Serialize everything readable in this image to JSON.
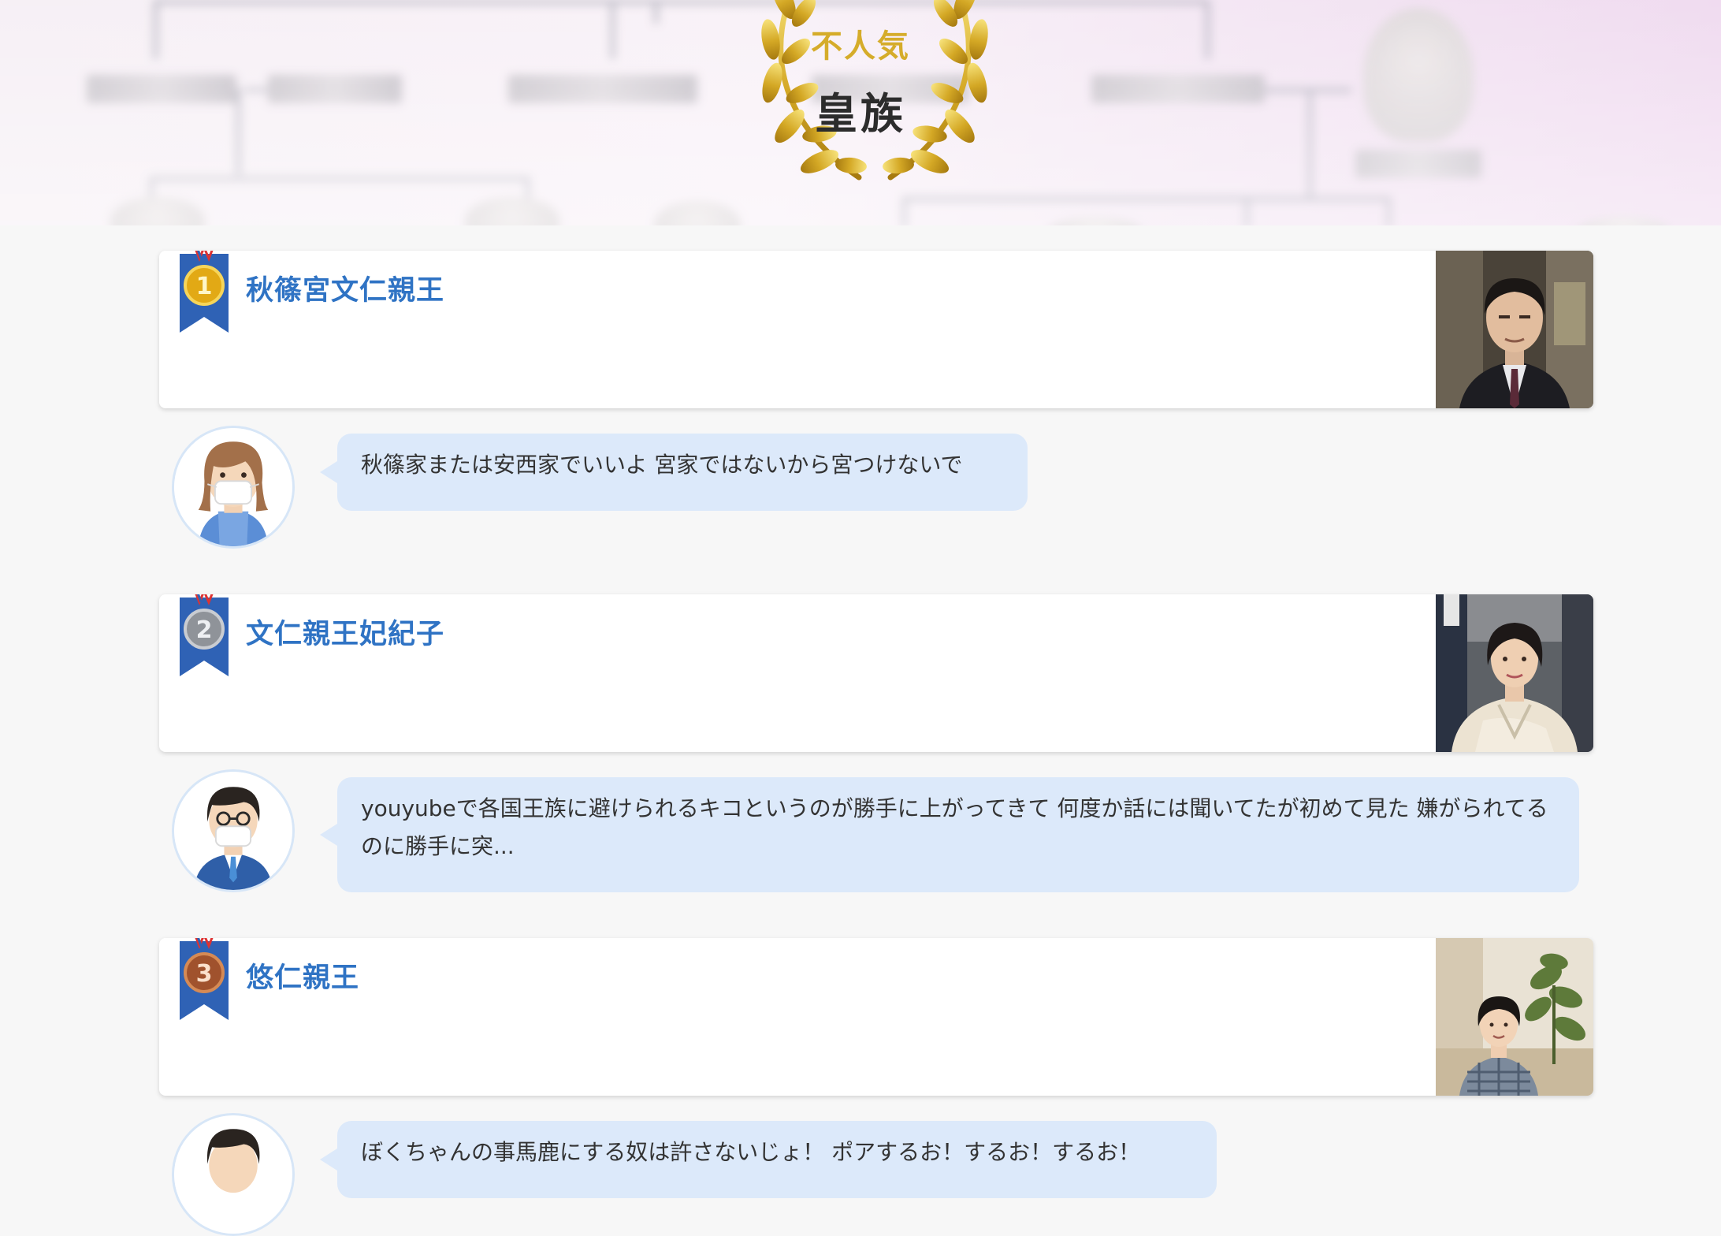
{
  "header": {
    "subtitle": "不人気",
    "title": "皇族"
  },
  "rankings": [
    {
      "rank": "1",
      "medal": "gold-medal-icon",
      "name": "秋篠宮文仁親王",
      "comment": "秋篠家または安西家でいいよ 宮家ではないから宮つけないで",
      "avatar": "woman-mask-avatar"
    },
    {
      "rank": "2",
      "medal": "silver-medal-icon",
      "name": "文仁親王妃紀子",
      "comment": "youyubeで各国王族に避けられるキコというのが勝手に上がってきて 何度か話には聞いてたが初めて見た 嫌がられてるのに勝手に突...",
      "avatar": "man-glasses-mask-avatar"
    },
    {
      "rank": "3",
      "medal": "bronze-medal-icon",
      "name": "悠仁親王",
      "comment": "ぼくちゃんの事馬鹿にする奴は許さないじょ！ ポアするお！するお！するお！",
      "avatar": "man-avatar"
    }
  ],
  "colors": {
    "accent_gold": "#d5ac2a",
    "name_blue": "#2f73c4",
    "bubble_bg": "#dce9fa",
    "ribbon_blue": "#2f62b5"
  }
}
